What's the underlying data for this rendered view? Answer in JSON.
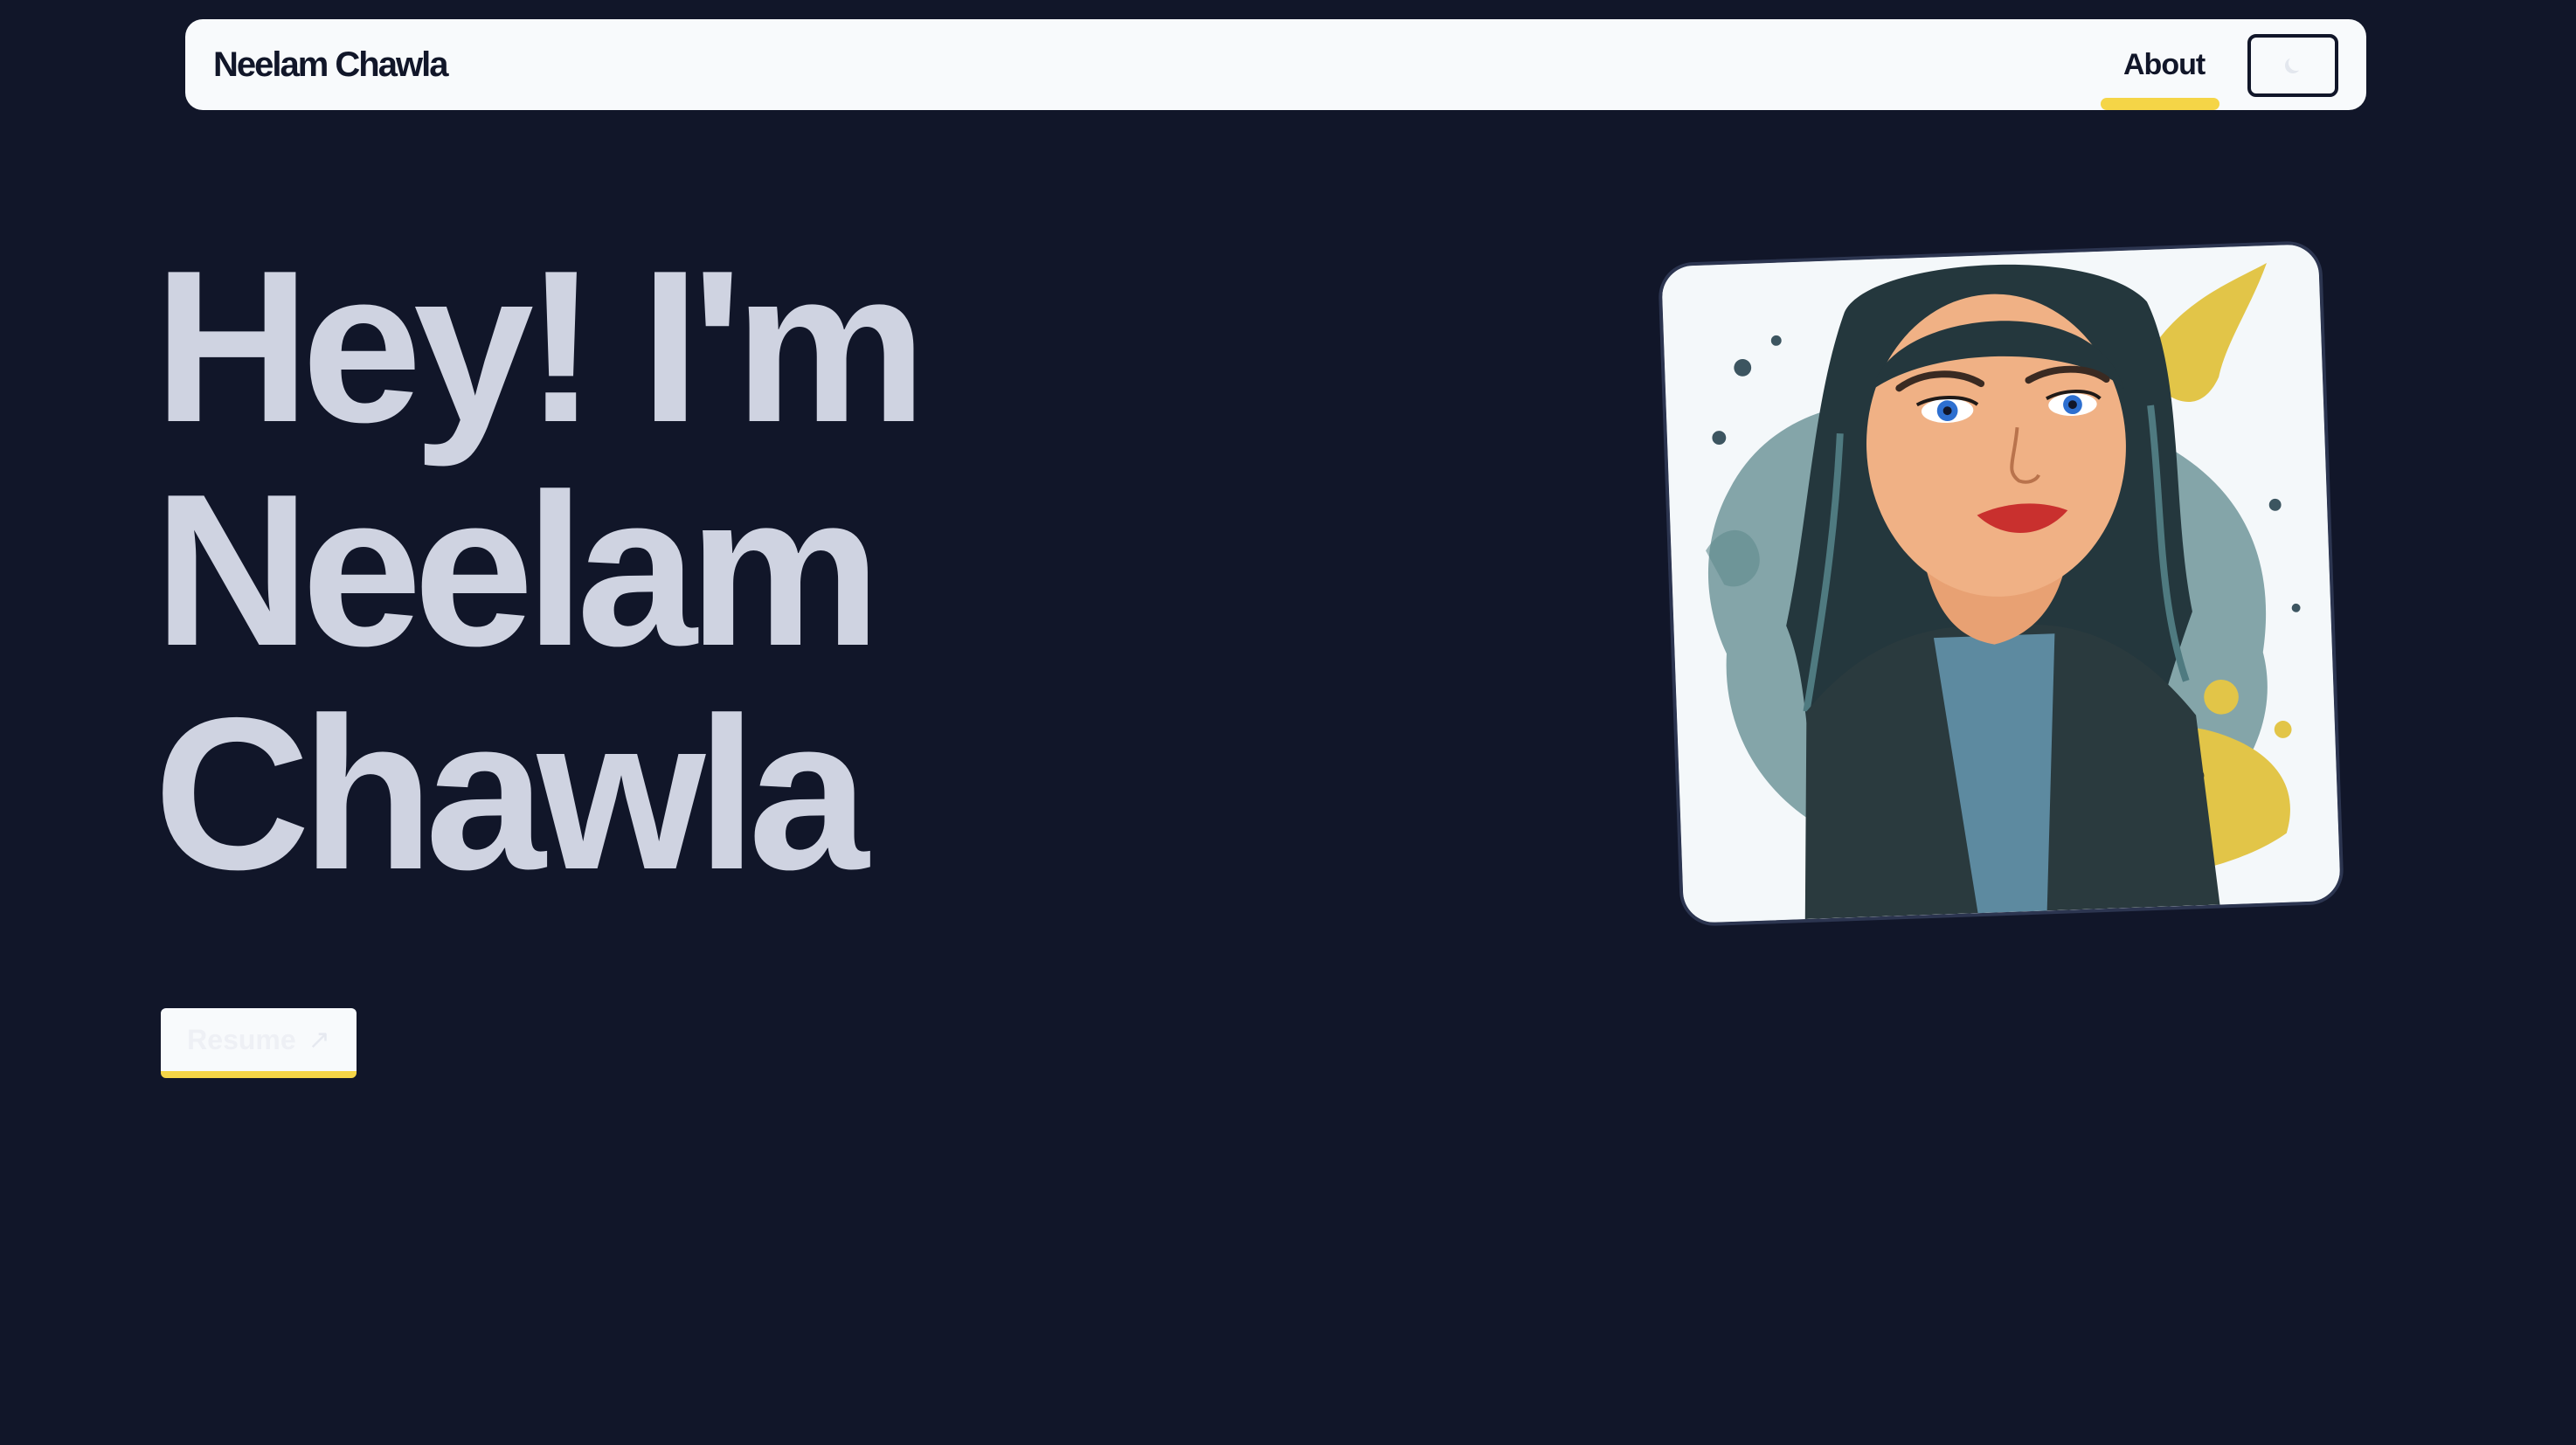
{
  "navbar": {
    "brand": "Neelam Chawla",
    "links": [
      {
        "label": "About",
        "active": true
      }
    ],
    "theme_toggle_icon": "moon-icon"
  },
  "hero": {
    "title_lines": [
      "Hey! I'm",
      "Neelam",
      "Chawla"
    ],
    "resume_button": {
      "label": "Resume",
      "icon": "arrow-up-right-icon"
    }
  },
  "portrait": {
    "description_icon": "portrait-illustration"
  },
  "colors": {
    "background": "#111629",
    "navbar": "#f8fafc",
    "heading": "#cfd3e1",
    "accent": "#f5d547",
    "dark_text": "#111629"
  }
}
